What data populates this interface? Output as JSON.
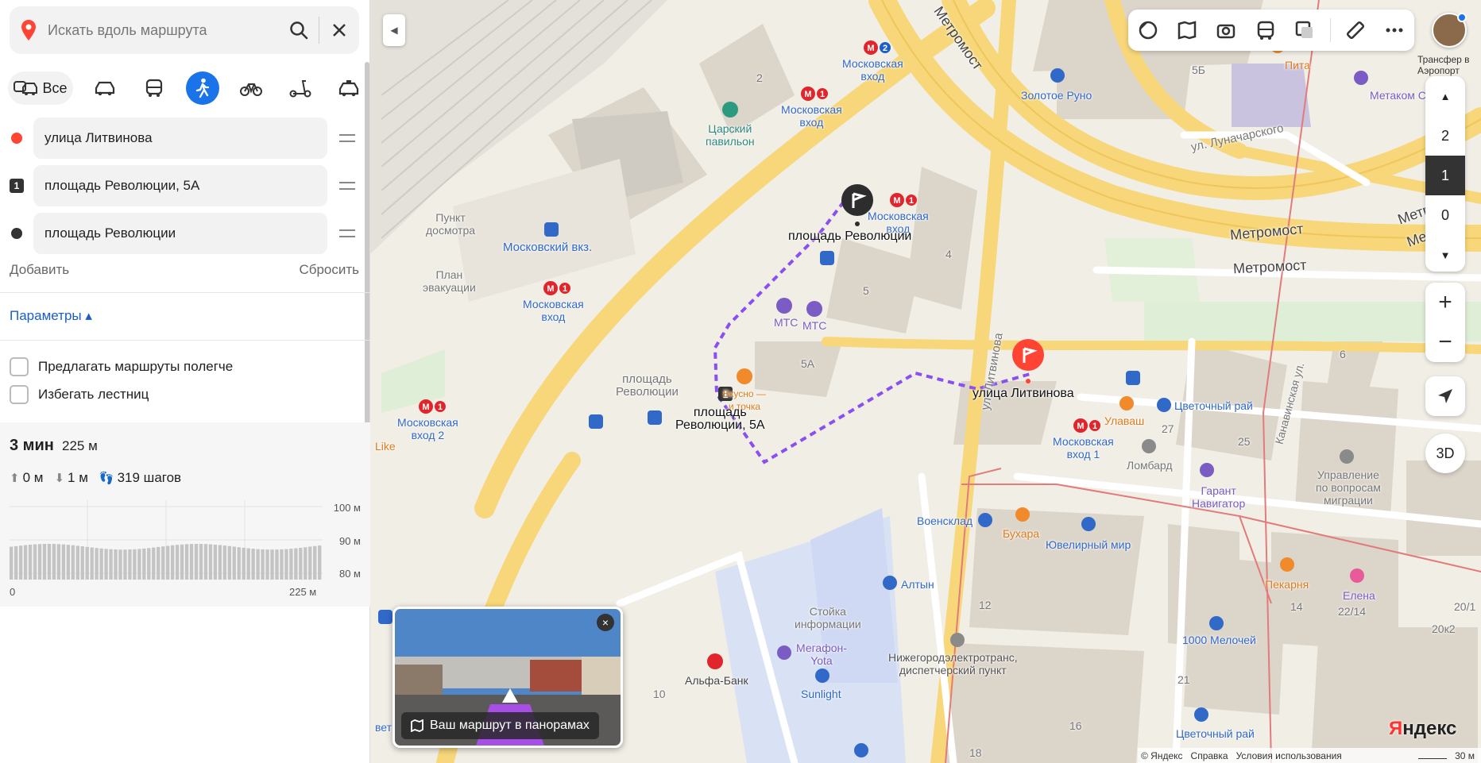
{
  "search": {
    "placeholder": "Искать вдоль маршрута"
  },
  "modes": {
    "all_label": "Все"
  },
  "waypoints": [
    {
      "value": "улица Литвинова"
    },
    {
      "badge": "1",
      "value": "площадь Революции, 5А"
    },
    {
      "value": "площадь Революции"
    }
  ],
  "actions": {
    "add": "Добавить",
    "reset": "Сбросить"
  },
  "params": {
    "label": "Параметры ▴"
  },
  "options": [
    "Предлагать маршруты полегче",
    "Избегать лестниц"
  ],
  "summary": {
    "time": "3 мин",
    "distance": "225 м",
    "ascent": "0 м",
    "descent": "1 м",
    "steps": "319 шагов"
  },
  "elevation": {
    "y_labels": [
      "100 м",
      "90 м",
      "80 м"
    ],
    "x_start": "0",
    "x_end": "225 м",
    "bar_level_frac": 0.45
  },
  "map": {
    "labels": {
      "metromost1": "Метромост",
      "metromost2": "Метромост",
      "metromost3": "Метромост",
      "metromost4": "Метром",
      "metromost5": "Метр",
      "lunacharskogo": "ул. Луначарского",
      "litvinova_street": "ул. Литвинова",
      "kanavinskaya": "Канавинская ул.",
      "moscow_entry_top": "Московская\nвход",
      "moscow_entry_top2": "Московская\nвход",
      "tsarsky": "Царский\nпавильон",
      "zolotoe_runo": "Золотое Руно",
      "pita": "Пита",
      "metakom": "Метаком Сервис",
      "punkt": "Пункт\nдосмотра",
      "moscow_station": "Московский вкз.",
      "plan": "План\nэвакуации",
      "moscow_entry_mid": "Московская\nвход",
      "moscow_entry_2": "Московская\nвход 2",
      "like": "Like",
      "moscow_entry_near": "Московская\nвход",
      "rev_square_top": "площадь Революции",
      "mts1": "МТС",
      "mts2": "МТС",
      "rev_square_gray": "площадь\nРеволюции",
      "vkusno": "Вкусно —\nи точка",
      "rev_5a": "площадь\nРеволюции, 5А",
      "litvinova_pin": "улица Литвинова",
      "tsvetochny1": "Цветочный рай",
      "ulavash": "Улаваш",
      "moscow_entry_1": "Московская\nвход 1",
      "lombard": "Ломбард",
      "garant": "Гарант\nНавигатор",
      "upravlenie": "Управление\nпо вопросам\nмиграции",
      "voensklad": "Военсклад",
      "bukhara": "Бухара",
      "yuvelirny": "Ювелирный мир",
      "pekarnya": "Пекарня",
      "elena": "Елена",
      "altyn": "Алтын",
      "stoika": "Стойка\nинформации",
      "megafon": "Мегафон-\nYota",
      "sunlight": "Sunlight",
      "nizhegorod": "Нижегородэлектротранс,\nдиспетчерский пункт",
      "alfa": "Альфа-Банк",
      "melochey": "1000 Мелочей",
      "tsvetochny2": "Цветочный рай",
      "vet": "вет",
      "n2": "2",
      "n5b": "5Б",
      "n4": "4",
      "n5": "5",
      "n5a": "5А",
      "n6": "6",
      "n27": "27",
      "n25": "25",
      "n12": "12",
      "n14": "14",
      "n2214": "22/14",
      "n201": "20/1",
      "n20k2": "20к2",
      "n21": "21",
      "n16": "16",
      "n18": "18",
      "n10": "10"
    }
  },
  "floors": [
    "▲",
    "2",
    "1",
    "0",
    "▼"
  ],
  "zoom": {
    "in": "+",
    "out": "−"
  },
  "btn_3d": "3D",
  "transfer_label": "Трансфер в\nАэропорт",
  "panorama": {
    "caption": "Ваш маршрут в панорамах",
    "close": "×"
  },
  "footer": {
    "copyright": "© Яндекс",
    "help": "Справка",
    "terms": "Условия использования",
    "scale": "30 м"
  },
  "logo": {
    "first": "Я",
    "rest": "ндекс"
  },
  "colors": {
    "accent": "#1a73e8",
    "route": "#8a4ff0",
    "start": "#f43",
    "metro": "#e0262c"
  }
}
